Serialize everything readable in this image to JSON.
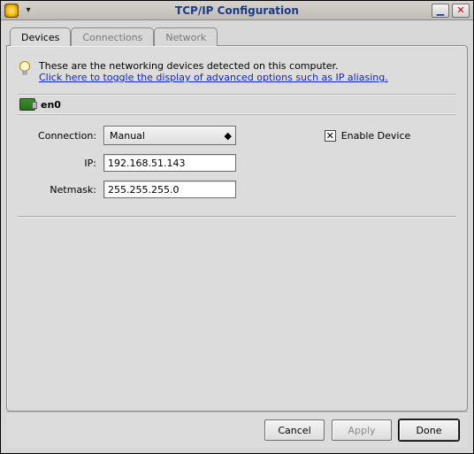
{
  "window": {
    "title": "TCP/IP Configuration"
  },
  "tabs": {
    "devices": "Devices",
    "connections": "Connections",
    "network": "Network"
  },
  "info": {
    "line1": "These are the networking devices detected on this computer.",
    "link": "Click here to toggle the display of advanced options such as IP aliasing."
  },
  "device": {
    "name": "en0"
  },
  "form": {
    "connection_label": "Connection:",
    "connection_value": "Manual",
    "ip_label": "IP:",
    "ip_value": "192.168.51.143",
    "netmask_label": "Netmask:",
    "netmask_value": "255.255.255.0",
    "enable_label": "Enable Device",
    "enable_checked": true
  },
  "buttons": {
    "cancel": "Cancel",
    "apply": "Apply",
    "done": "Done"
  },
  "glyphs": {
    "checkmark": "✕",
    "menu_arrow": "▾",
    "combo_arrow": "◆",
    "close_x": "✕",
    "minimize": "▁"
  }
}
